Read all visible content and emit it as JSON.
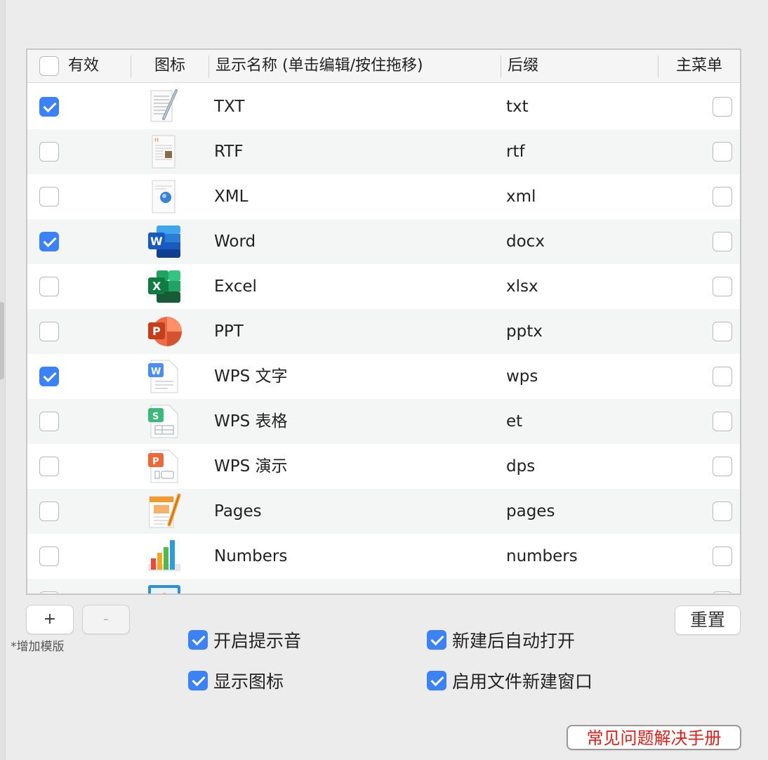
{
  "header": {
    "valid": "有效",
    "icon": "图标",
    "name": "显示名称 (单击编辑/按住拖移)",
    "suffix": "后缀",
    "menu": "主菜单"
  },
  "rows": [
    {
      "name": "TXT",
      "suffix": "txt",
      "valid": true,
      "menu": false,
      "icon": "txt-file-icon"
    },
    {
      "name": "RTF",
      "suffix": "rtf",
      "valid": false,
      "menu": false,
      "icon": "rtf-file-icon"
    },
    {
      "name": "XML",
      "suffix": "xml",
      "valid": false,
      "menu": false,
      "icon": "xml-file-icon"
    },
    {
      "name": "Word",
      "suffix": "docx",
      "valid": true,
      "menu": false,
      "icon": "word-icon"
    },
    {
      "name": "Excel",
      "suffix": "xlsx",
      "valid": false,
      "menu": false,
      "icon": "excel-icon"
    },
    {
      "name": "PPT",
      "suffix": "pptx",
      "valid": false,
      "menu": false,
      "icon": "powerpoint-icon"
    },
    {
      "name": "WPS 文字",
      "suffix": "wps",
      "valid": true,
      "menu": false,
      "icon": "wps-writer-icon"
    },
    {
      "name": "WPS 表格",
      "suffix": "et",
      "valid": false,
      "menu": false,
      "icon": "wps-spreadsheet-icon"
    },
    {
      "name": "WPS 演示",
      "suffix": "dps",
      "valid": false,
      "menu": false,
      "icon": "wps-presentation-icon"
    },
    {
      "name": "Pages",
      "suffix": "pages",
      "valid": false,
      "menu": false,
      "icon": "pages-icon"
    },
    {
      "name": "Numbers",
      "suffix": "numbers",
      "valid": false,
      "menu": false,
      "icon": "numbers-icon"
    }
  ],
  "buttons": {
    "add": "+",
    "remove": "-",
    "reset": "重置",
    "faq": "常见问题解决手册"
  },
  "add_hint": "*增加模版",
  "options": {
    "sound": {
      "label": "开启提示音",
      "checked": true
    },
    "auto_open": {
      "label": "新建后自动打开",
      "checked": true
    },
    "show_icon": {
      "label": "显示图标",
      "checked": true
    },
    "new_window": {
      "label": "启用文件新建窗口",
      "checked": true
    }
  },
  "colors": {
    "accent": "#3b82f6",
    "faq_text": "#e0201a"
  }
}
